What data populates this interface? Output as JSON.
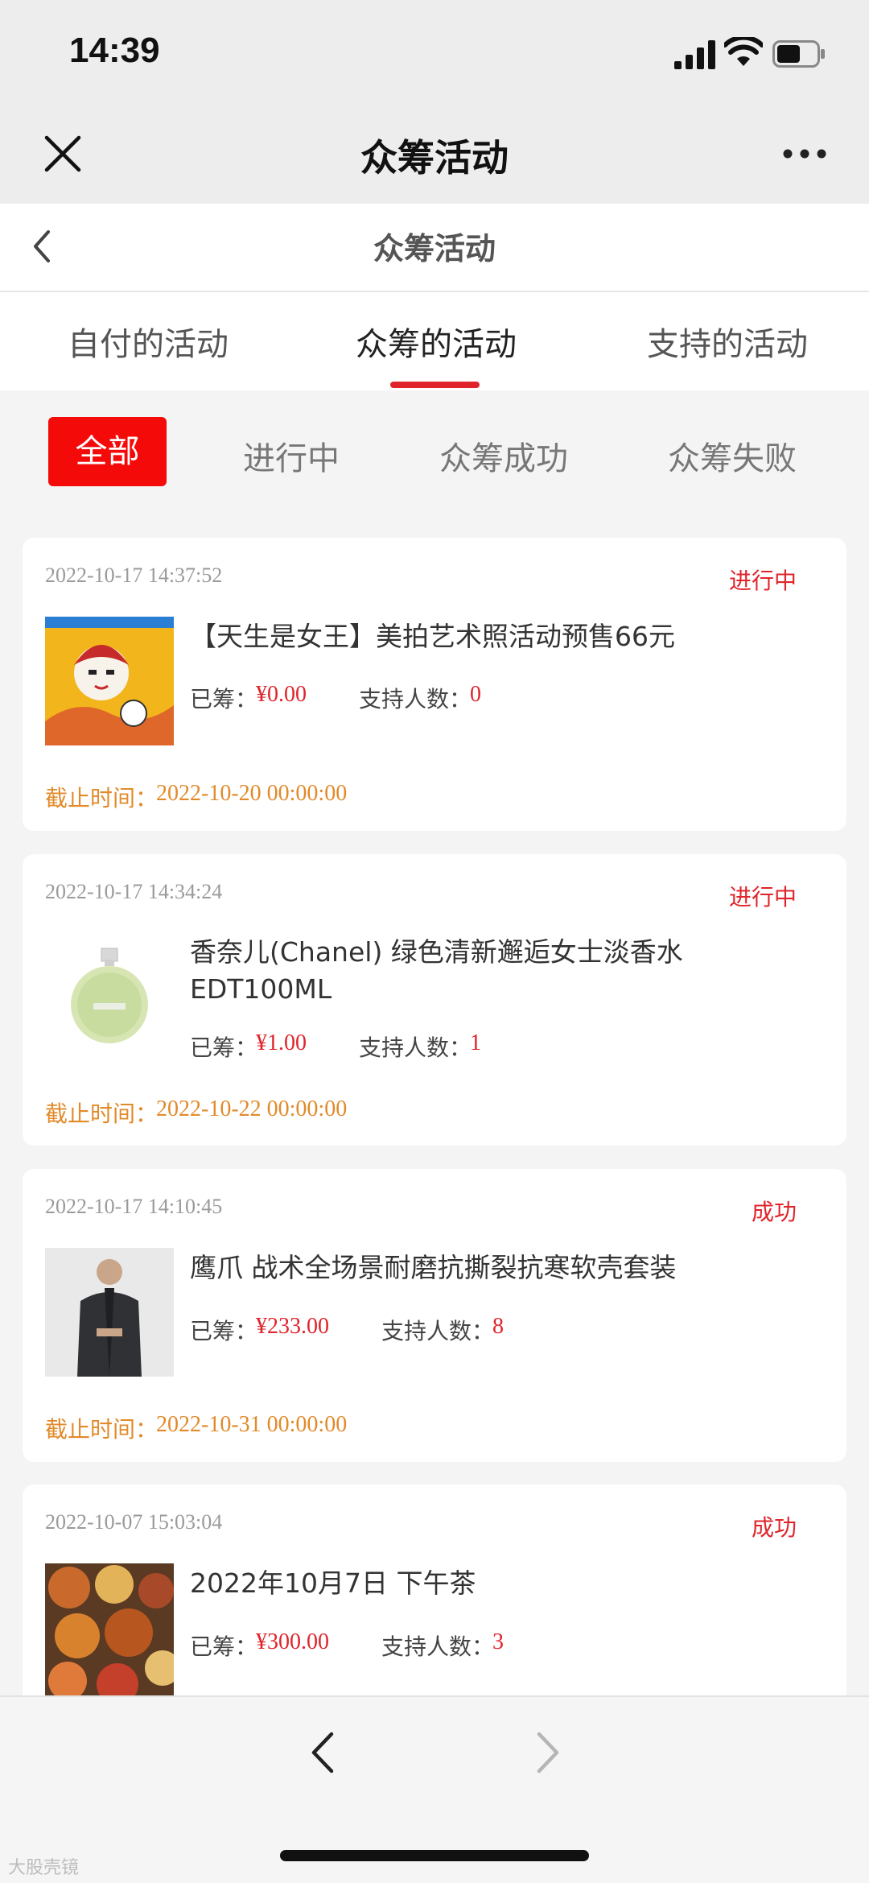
{
  "status_bar": {
    "time": "14:39"
  },
  "wechat_header": {
    "title": "众筹活动"
  },
  "page_header": {
    "title": "众筹活动"
  },
  "tabs": [
    {
      "label": "自付的活动"
    },
    {
      "label": "众筹的活动"
    },
    {
      "label": "支持的活动"
    }
  ],
  "filters": [
    {
      "label": "全部"
    },
    {
      "label": "进行中"
    },
    {
      "label": "众筹成功"
    },
    {
      "label": "众筹失败"
    }
  ],
  "labels": {
    "raised": "已筹：",
    "supporters": "支持人数：",
    "deadline": "截止时间："
  },
  "cards": [
    {
      "timestamp": "2022-10-17 14:37:52",
      "status": "进行中",
      "name": "【天生是女王】美拍艺术照活动预售66元",
      "raised": "¥0.00",
      "supporters": "0",
      "deadline": "2022-10-20 00:00:00"
    },
    {
      "timestamp": "2022-10-17 14:34:24",
      "status": "进行中",
      "name": "香奈儿(Chanel) 绿色清新邂逅女士淡香水EDT100ML",
      "raised": "¥1.00",
      "supporters": "1",
      "deadline": "2022-10-22 00:00:00"
    },
    {
      "timestamp": "2022-10-17 14:10:45",
      "status": "成功",
      "name": "鹰爪 战术全场景耐磨抗撕裂抗寒软壳套装",
      "raised": "¥233.00",
      "supporters": "8",
      "deadline": "2022-10-31 00:00:00"
    },
    {
      "timestamp": "2022-10-07 15:03:04",
      "status": "成功",
      "name": "2022年10月7日 下午茶",
      "raised": "¥300.00",
      "supporters": "3"
    }
  ],
  "watermark": "大股壳镜",
  "colors": {
    "accent": "#e0242c",
    "filter_active": "#f50a0a",
    "deadline": "#e28a2a"
  }
}
